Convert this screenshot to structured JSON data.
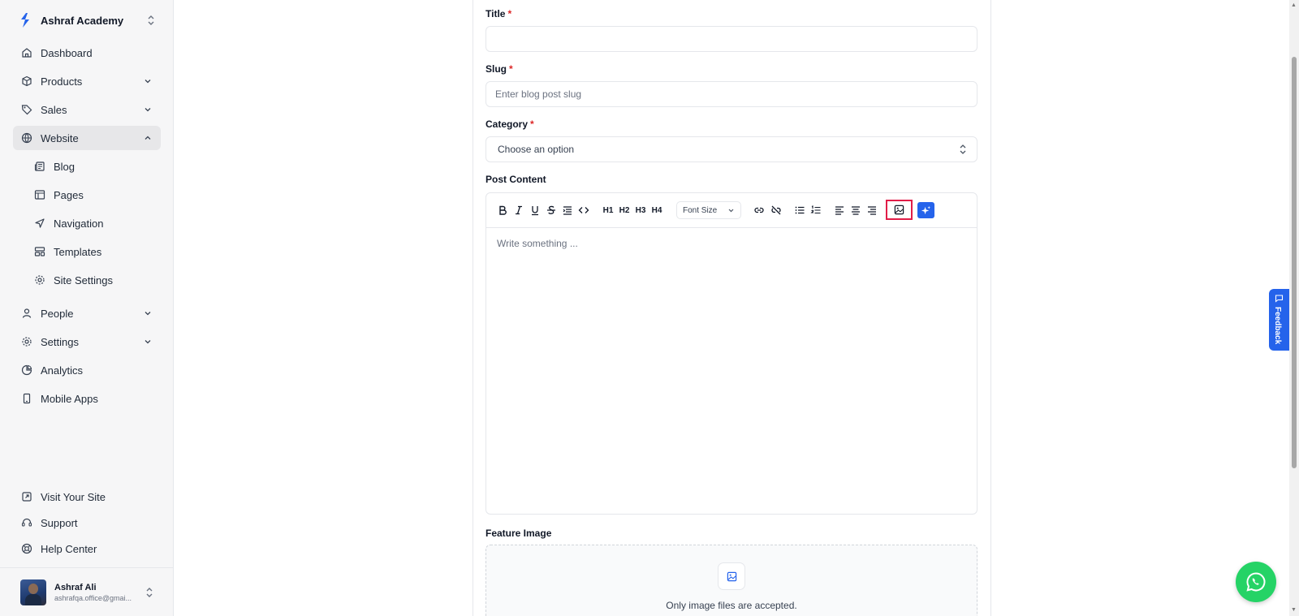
{
  "brand": {
    "name": "Ashraf Academy",
    "accent": "#2563eb"
  },
  "sidebar": {
    "items": [
      {
        "label": "Dashboard",
        "icon": "home-icon"
      },
      {
        "label": "Products",
        "icon": "box-icon",
        "expandable": true
      },
      {
        "label": "Sales",
        "icon": "tag-icon",
        "expandable": true
      },
      {
        "label": "Website",
        "icon": "globe-icon",
        "expandable": true,
        "expanded": true,
        "active": true
      },
      {
        "label": "Blog",
        "icon": "newspaper-icon",
        "sub": true
      },
      {
        "label": "Pages",
        "icon": "layout-icon",
        "sub": true
      },
      {
        "label": "Navigation",
        "icon": "navigation-icon",
        "sub": true
      },
      {
        "label": "Templates",
        "icon": "template-icon",
        "sub": true
      },
      {
        "label": "Site Settings",
        "icon": "gear-icon",
        "sub": true
      },
      {
        "label": "People",
        "icon": "user-icon",
        "expandable": true
      },
      {
        "label": "Settings",
        "icon": "gear-icon",
        "expandable": true
      },
      {
        "label": "Analytics",
        "icon": "pie-chart-icon"
      },
      {
        "label": "Mobile Apps",
        "icon": "mobile-icon"
      }
    ],
    "bottom": [
      {
        "label": "Visit Your Site",
        "icon": "external-link-icon"
      },
      {
        "label": "Support",
        "icon": "headset-icon"
      },
      {
        "label": "Help Center",
        "icon": "lifebuoy-icon"
      }
    ],
    "user": {
      "name": "Ashraf Ali",
      "email": "ashrafqa.office@gmai..."
    }
  },
  "form": {
    "title": {
      "label": "Title",
      "required": "*",
      "value": ""
    },
    "slug": {
      "label": "Slug",
      "required": "*",
      "placeholder": "Enter blog post slug"
    },
    "category": {
      "label": "Category",
      "required": "*",
      "value": "Choose an option"
    },
    "content": {
      "label": "Post Content",
      "font_size": "Font Size",
      "placeholder": "Write something ..."
    },
    "feature_image": {
      "label": "Feature Image",
      "hint": "Only image files are accepted."
    }
  },
  "editor_toolbar": {
    "headings": [
      "H1",
      "H2",
      "H3",
      "H4"
    ],
    "highlighted_button": "image-button",
    "highlight_color": "#e11d48"
  },
  "feedback": {
    "label": "Feedback"
  },
  "colors": {
    "required": "#dc2626",
    "whatsapp": "#25d366"
  }
}
